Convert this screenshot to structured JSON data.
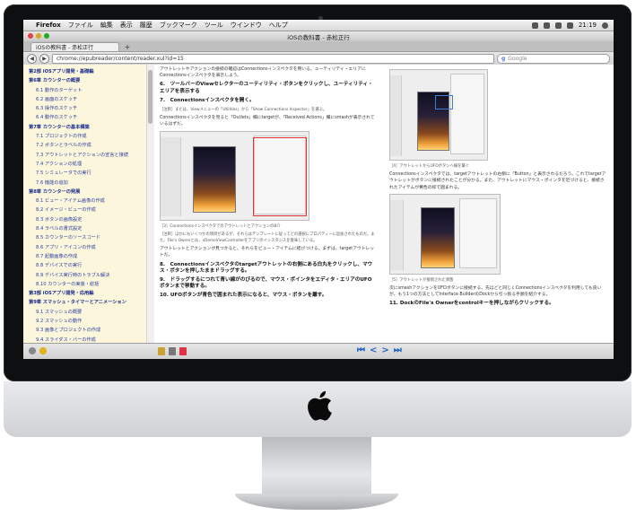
{
  "menubar": {
    "app": "Firefox",
    "items": [
      "ファイル",
      "編集",
      "表示",
      "履歴",
      "ブックマーク",
      "ツール",
      "ウインドウ",
      "ヘルプ"
    ],
    "clock": "21:19"
  },
  "window": {
    "title": "iOSの教科書 - 赤松正行"
  },
  "tabs": [
    {
      "label": "iOSの教科書 - 赤松正行"
    }
  ],
  "nav": {
    "url": "chrome://epubreader/content/reader.xul?id=15",
    "search_placeholder": "Google"
  },
  "sidebar": {
    "items": [
      {
        "label": "第2部 iOSアプリ開発・基礎編",
        "type": "chap"
      },
      {
        "label": "第6章 カウンターの概要",
        "type": "chap"
      },
      {
        "label": "6.1 動作のターゲット",
        "type": "sub"
      },
      {
        "label": "6.2 画面のスケッチ",
        "type": "sub"
      },
      {
        "label": "6.3 操作のスケッチ",
        "type": "sub"
      },
      {
        "label": "6.4 動作のスケッチ",
        "type": "sub"
      },
      {
        "label": "第7章 カウンターの基本構築",
        "type": "chap"
      },
      {
        "label": "7.1 プロジェクトの作成",
        "type": "sub"
      },
      {
        "label": "7.2 ボタンとラベルの作成",
        "type": "sub"
      },
      {
        "label": "7.3 アウトレットとアクションの宣言と接続",
        "type": "sub"
      },
      {
        "label": "7.4 アクションの処理",
        "type": "sub"
      },
      {
        "label": "7.5 シミュレータでの実行",
        "type": "sub"
      },
      {
        "label": "7.6 機能の追加",
        "type": "sub"
      },
      {
        "label": "第8章 カウンターの発展",
        "type": "chap"
      },
      {
        "label": "8.1 ビュー・アイテム画像の作成",
        "type": "sub"
      },
      {
        "label": "8.2 イメージ・ビューの作成",
        "type": "sub"
      },
      {
        "label": "8.3 ボタンの画像設定",
        "type": "sub"
      },
      {
        "label": "8.4 ラベルの書式設定",
        "type": "sub"
      },
      {
        "label": "8.5 カウンターのソースコード",
        "type": "sub"
      },
      {
        "label": "8.6 アプリ・アイコンの作成",
        "type": "sub"
      },
      {
        "label": "8.7 起動画像の作成",
        "type": "sub"
      },
      {
        "label": "8.8 デバイスでの実行",
        "type": "sub"
      },
      {
        "label": "8.9 デバイス実行時のトラブル解決",
        "type": "sub"
      },
      {
        "label": "8.10 カウンターの実装・総括",
        "type": "sub"
      },
      {
        "label": "第3部 iOSアプリ開発・応用編",
        "type": "chap"
      },
      {
        "label": "第9章 スマッシュ・タイマーとアニメーション",
        "type": "chap"
      },
      {
        "label": "9.1 スマッシュの概要",
        "type": "sub"
      },
      {
        "label": "9.2 スマッシュの動作",
        "type": "sub"
      },
      {
        "label": "9.3 画像とプロジェクトの作成",
        "type": "sub"
      },
      {
        "label": "9.4 スライダス・バーの作成",
        "type": "sub"
      },
      {
        "label": "9.5 ビュー・アイテムの作成",
        "type": "sub"
      },
      {
        "label": "9.6 アウトレットやアクションの作成",
        "type": "sub"
      }
    ]
  },
  "left_column": {
    "intro": "アウトレットやアクションの接続の確認はConnectionsインスペクタを用いる。ユーティリティ・エリアにConnectionsインスペクタを表示しよう。",
    "step6": "6.　ツールバーのViewセレクターのユーティリティ・ボタンをクリックし、ユーティリティ・エリアを表示する",
    "step7": "7.　Connectionsインスペクタを開く。",
    "note7": "［注釈］または、Viewメニューの「Utilities」から「Show Connections Inspector」を選ぶ。",
    "para7": "Connectionsインスペクタを見ると「Outlets」欄にtargetが、「Received Actions」欄にsmashが表示されているはずだ。",
    "fig3": "［3］ConnectionsインスペクタでのアウトレットとアクションのB介",
    "fig3_note": "［注釈］ほかにもいくつかの項目があるが、それらはテンプレートに従ってどの選択にプロパティーに追加されたものだ。また、File's Ownerとは、xDemoViewControllerをアプリのインスタンスを意味している。",
    "para8a": "アウトレットとアクションが見つかると、それらをビュー・アイテムに結びつける。まずは、targetアウトレットだ。",
    "step8": "8.　Connectionsインスペクタのtargetアウトレットの右側にある白丸をクリックし、マウス・ボタンを押したままドラッグする。",
    "step9": "9.　ドラッグするにつれて青い線がのびるので、マウス・ポインタをエディタ・エリアのUFOボタンまで移動する。",
    "step10": "10. UFOボタンが青色で囲まれた表示になると、マウス・ボタンを離す。"
  },
  "right_column": {
    "fig4": "［4］アウトレットからUFOボタンへ線を繋ぐ",
    "para4": "Connectionsインスペクタでは、targetアウトレットの右側に「Button」と表示されるだろう。これでtargetアウトレットがボタンに接続されたことが分かる。また、アウトレットにマウス・ポインタを近づけると、接続されたアイテムが黄色の枠で囲まれる。",
    "fig5": "［5］アウトレットが接続された状態",
    "para5": "次にsmashアクションをUFOボタンに接続する。先ほどと同じくConnectionsインスペクタを利用しても良いが、もう1つの方法としてInterface BuilderのDockから引っ張る手順を紹介する。",
    "step11": "11. DockのFile's Ownerをcontrolキーを押しながらクリックする。"
  },
  "pager": {
    "first": "⏮",
    "prev": "<",
    "next": ">",
    "last": "⏭"
  }
}
